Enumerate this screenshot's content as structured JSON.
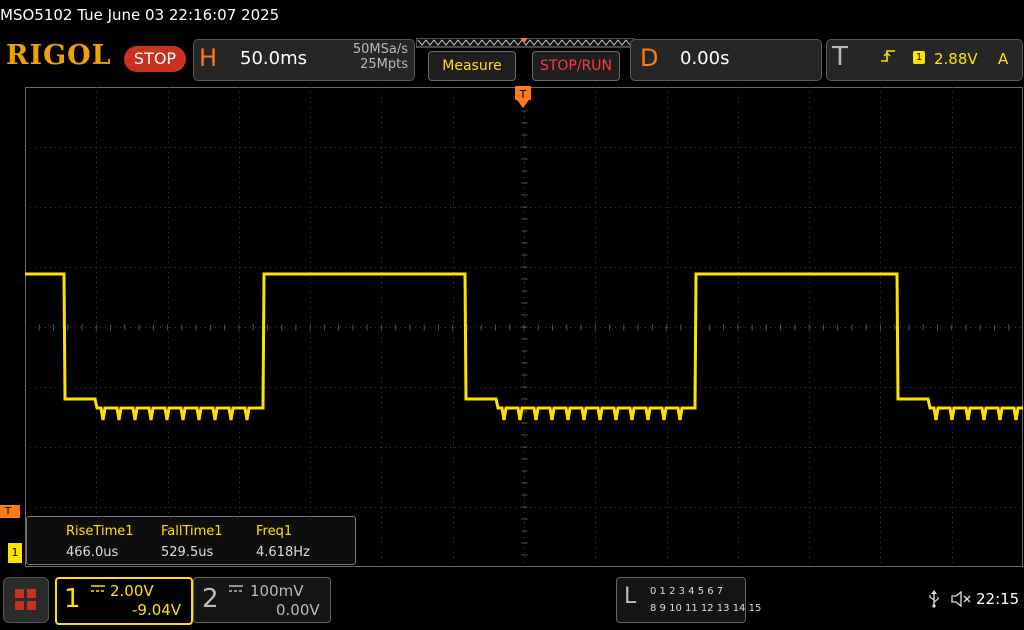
{
  "title_bar": {
    "text": "MSO5102  Tue June 03 22:16:07 2025"
  },
  "toolbar": {
    "logo": "RIGOL",
    "run_state": "STOP",
    "horizontal": {
      "letter": "H",
      "timebase": "50.0ms",
      "sample_rate": "50MSa/s",
      "memory_depth": "25Mpts"
    },
    "measure_label": "Measure",
    "stop_run_label": "STOP/RUN",
    "delay": {
      "letter": "D",
      "value": "0.00s"
    },
    "trigger": {
      "letter": "T",
      "source": "1",
      "level": "2.88V",
      "mode": "A"
    }
  },
  "markers": {
    "trigger_position": "T",
    "trigger_level": "T",
    "ch1": "1"
  },
  "measurements": [
    {
      "name": "RiseTime1",
      "value": "466.0us"
    },
    {
      "name": "FallTime1",
      "value": "529.5us"
    },
    {
      "name": "Freq1",
      "value": "4.618Hz"
    }
  ],
  "channels": {
    "ch1": {
      "number": "1",
      "scale": "2.00V",
      "offset": "-9.04V",
      "color": "#ffe100"
    },
    "ch2": {
      "number": "2",
      "scale": "100mV",
      "offset": "0.00V",
      "color": "#bbbbbb"
    }
  },
  "logic": {
    "letter": "L",
    "row1": "0 1 2 3   4 5 6 7",
    "row2": "8  9 10 11  12 13 14 15"
  },
  "status": {
    "clock": "22:15",
    "usb_icon": "usb-icon",
    "speaker_icon": "speaker-muted-icon"
  },
  "colors": {
    "trace": "#ffe100",
    "accent": "#ff7a1a",
    "grid": "#3c3c3c"
  }
}
